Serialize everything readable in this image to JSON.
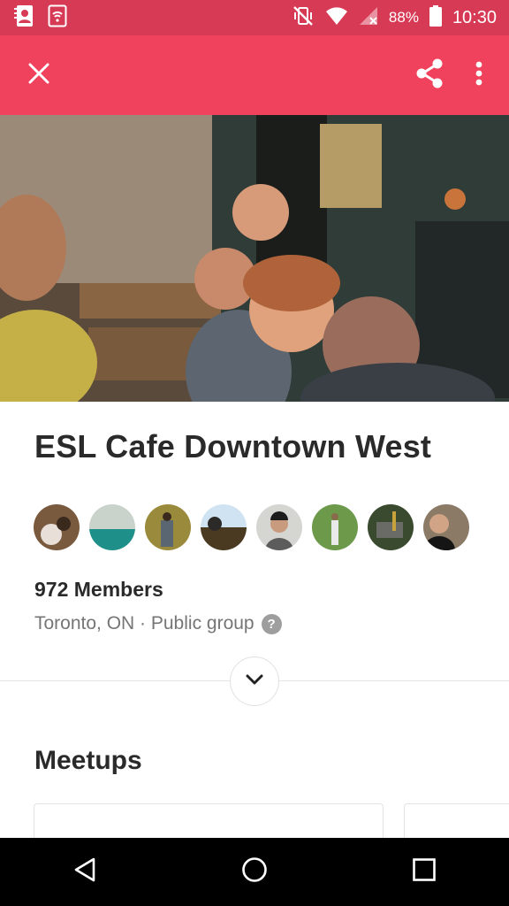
{
  "status_bar": {
    "battery_percent": "88%",
    "time": "10:30",
    "icons": [
      "contacts-notification-icon",
      "wifi-notification-icon",
      "vibrate-off-icon",
      "wifi-icon",
      "cellular-no-signal-icon",
      "battery-icon"
    ]
  },
  "app_bar": {
    "icons": [
      "close-icon",
      "share-icon",
      "more-vert-icon"
    ],
    "color": "#f0425c"
  },
  "group": {
    "name": "ESL Cafe Downtown West",
    "members": "972 Members",
    "location": "Toronto, ON · Public group",
    "help_icon": "?"
  },
  "member_avatars": [
    "avatar-1",
    "avatar-2",
    "avatar-3",
    "avatar-4",
    "avatar-5",
    "avatar-6",
    "avatar-7",
    "avatar-8"
  ],
  "sections": {
    "meetups_title": "Meetups"
  },
  "nav_bar": {
    "icons": [
      "back-icon",
      "home-icon",
      "recents-icon"
    ]
  },
  "colors": {
    "status_bar": "#d73a55",
    "accent": "#f0425c",
    "text_primary": "#2a2a2a",
    "text_secondary": "#757575"
  }
}
